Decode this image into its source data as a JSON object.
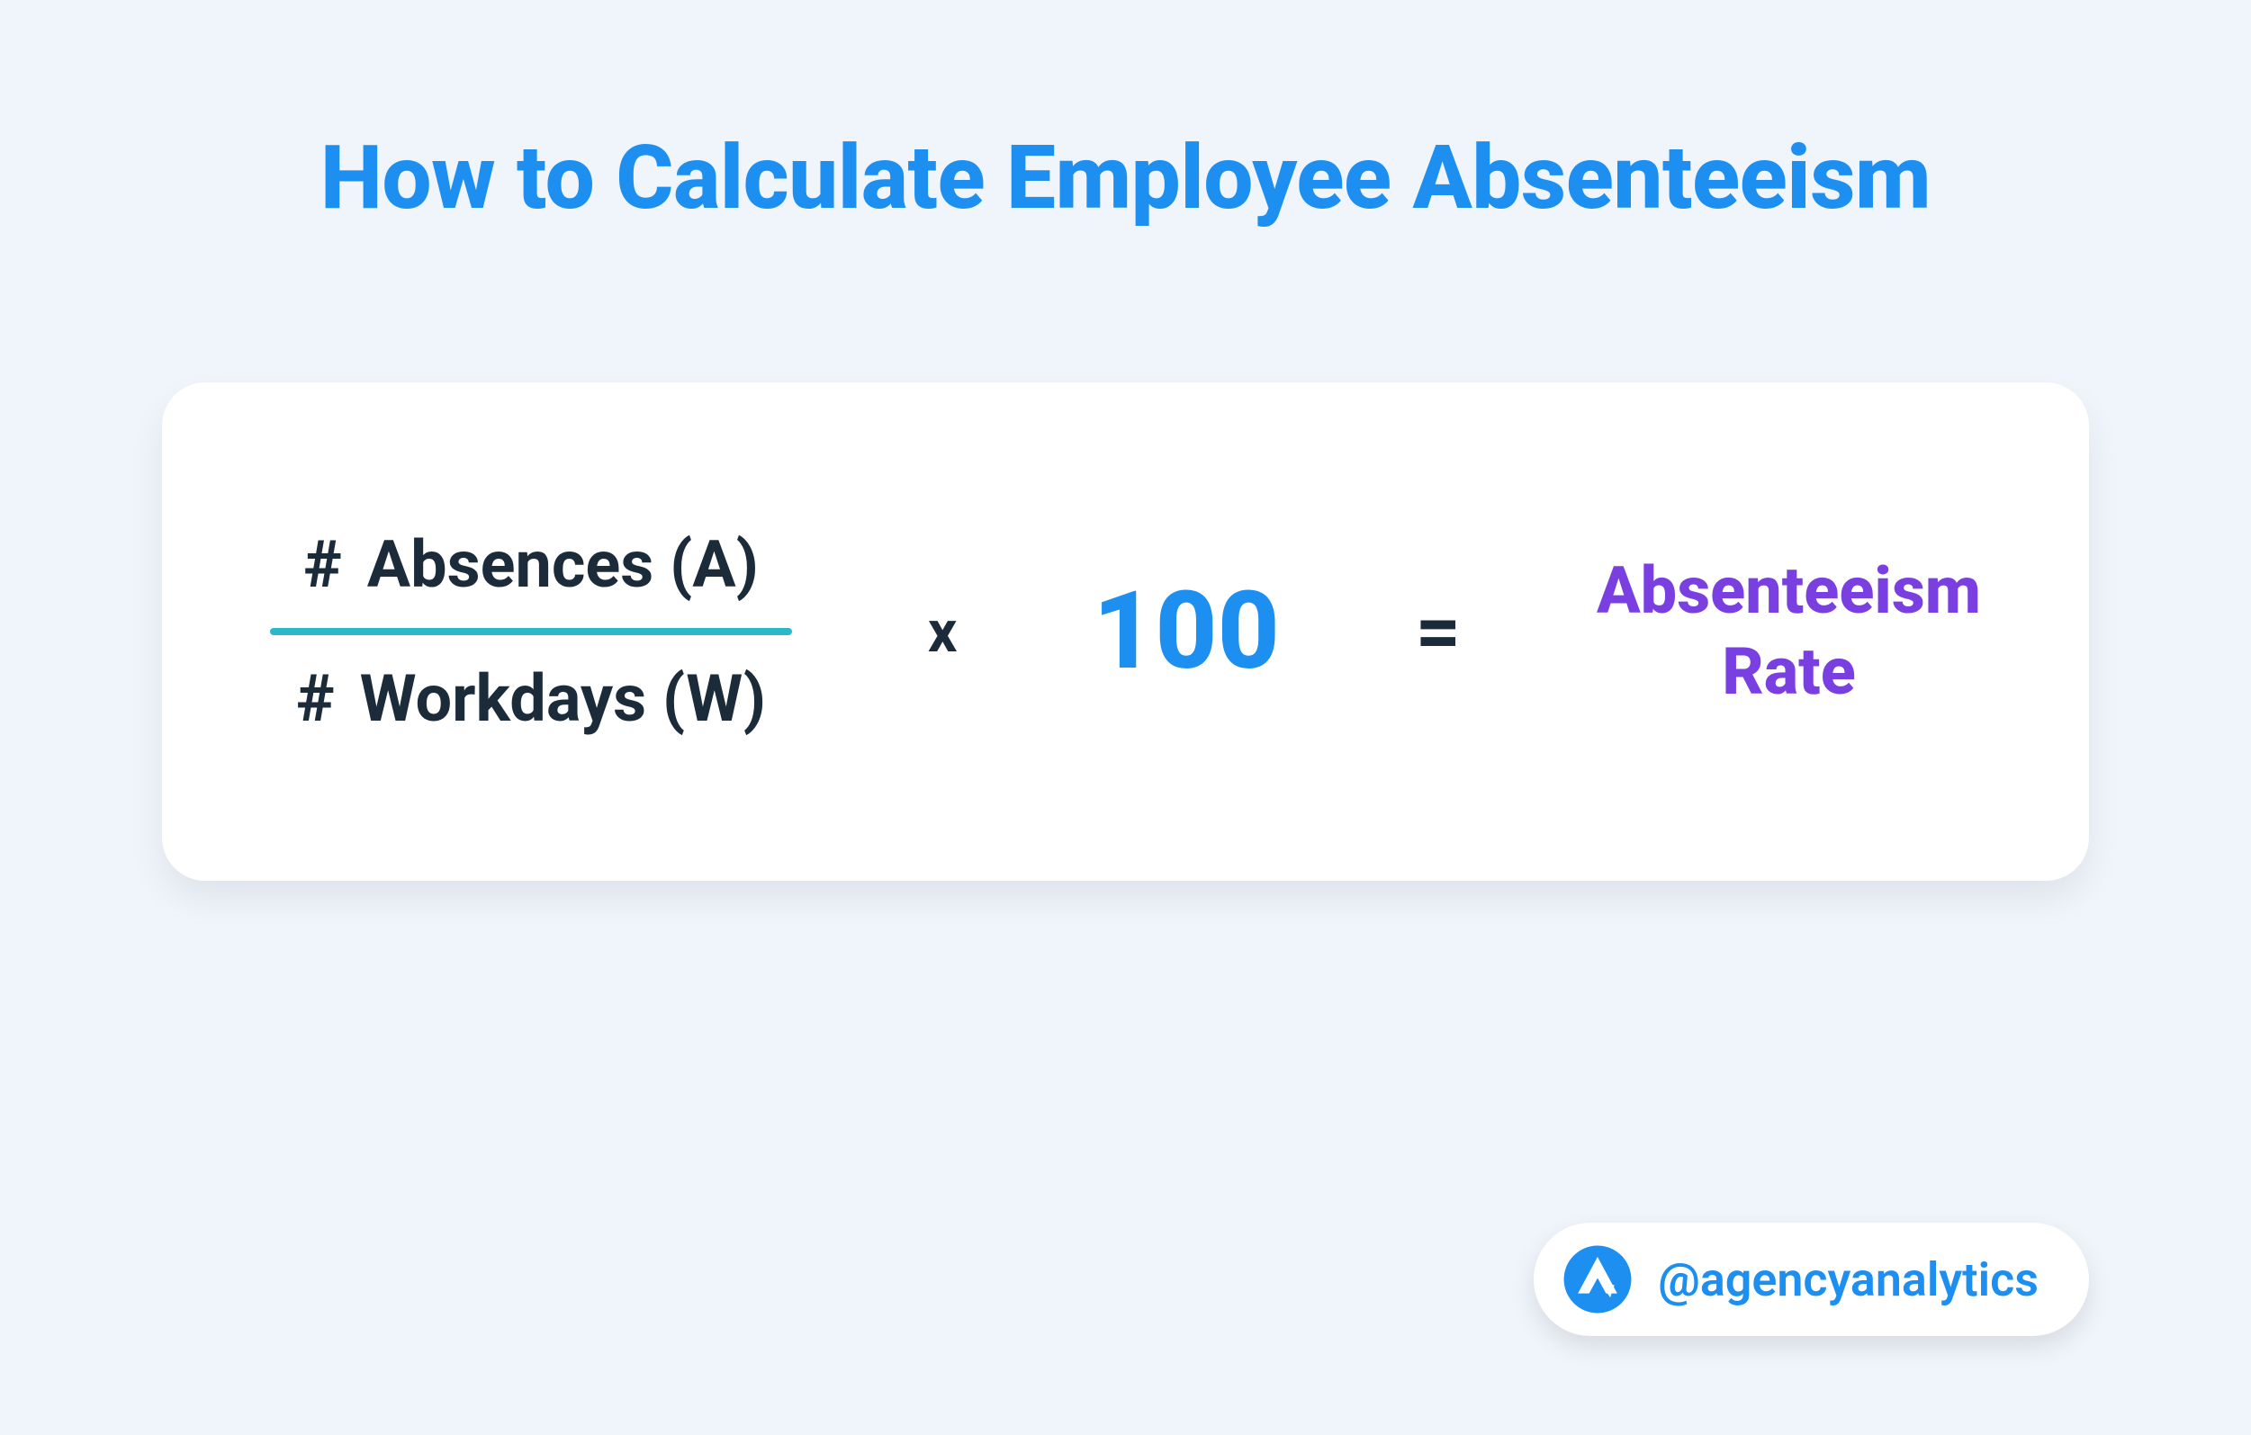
{
  "title": "How to Calculate Employee Absenteeism",
  "formula": {
    "hash": "#",
    "numerator": "Absences (A)",
    "denominator": "Workdays (W)",
    "multiply": "x",
    "multiplier": "100",
    "equals": "=",
    "result_line1": "Absenteeism",
    "result_line2": "Rate"
  },
  "brand": {
    "handle": "@agencyanalytics"
  },
  "colors": {
    "background": "#f0f4fb",
    "title": "#1d8ff0",
    "text_dark": "#1c2b3a",
    "divider": "#2bb8c9",
    "accent_blue": "#1d8ff0",
    "result_purple": "#7a3fe0"
  }
}
